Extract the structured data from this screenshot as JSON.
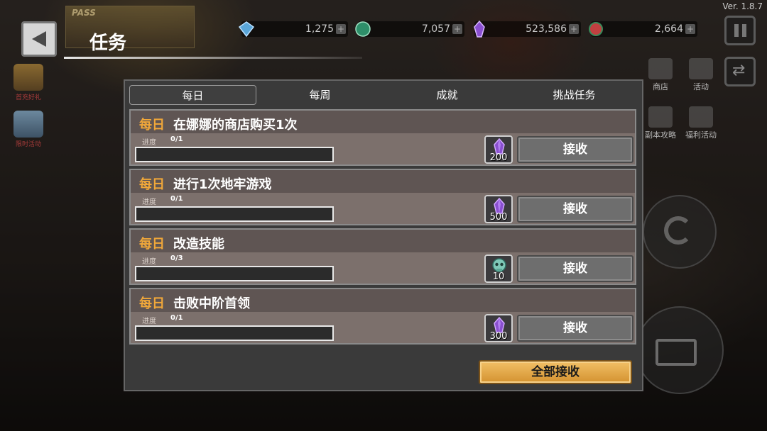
{
  "version": "Ver. 1.8.7",
  "pass_banner": {
    "label": "PASS"
  },
  "currencies": [
    {
      "icon": "diamond-icon",
      "value": "1,275",
      "color": "#5aa6d8"
    },
    {
      "icon": "coin-icon",
      "value": "7,057",
      "color": "#2e8f6a"
    },
    {
      "icon": "crystal-icon",
      "value": "523,586",
      "color": "#8a4fd0"
    },
    {
      "icon": "gem-icon",
      "value": "2,664",
      "color": "#c04040"
    }
  ],
  "header": {
    "title": "任务"
  },
  "left_side": [
    {
      "label": "首充好礼"
    },
    {
      "label": "限时活动"
    }
  ],
  "right_side": [
    {
      "label": "商店"
    },
    {
      "label": "活动"
    },
    {
      "label": "副本攻略"
    },
    {
      "label": "福利活动"
    }
  ],
  "tabs": [
    {
      "label": "每日",
      "active": true
    },
    {
      "label": "每周",
      "active": false
    },
    {
      "label": "成就",
      "active": false
    },
    {
      "label": "挑战任务",
      "active": false
    }
  ],
  "progress_label": "进度",
  "quests": [
    {
      "type": "每日",
      "title": "在娜娜的商店购买1次",
      "progress": "0/1",
      "progress_fraction": 0,
      "reward_icon": "purple-crystal-icon",
      "reward_amount": "200",
      "button_label": "接收"
    },
    {
      "type": "每日",
      "title": "进行1次地牢游戏",
      "progress": "0/1",
      "progress_fraction": 0,
      "reward_icon": "purple-crystal-icon",
      "reward_amount": "500",
      "button_label": "接收"
    },
    {
      "type": "每日",
      "title": "改造技能",
      "progress": "0/3",
      "progress_fraction": 0,
      "reward_icon": "skull-token-icon",
      "reward_amount": "10",
      "button_label": "接收"
    },
    {
      "type": "每日",
      "title": "击败中阶首领",
      "progress": "0/1",
      "progress_fraction": 0,
      "reward_icon": "purple-crystal-icon",
      "reward_amount": "300",
      "button_label": "接收"
    }
  ],
  "receive_all_label": "全部接收",
  "colors": {
    "accent_gold": "#f1a83a",
    "receive_all": "#e0a84a",
    "panel_bg": "#3a3a3a"
  }
}
